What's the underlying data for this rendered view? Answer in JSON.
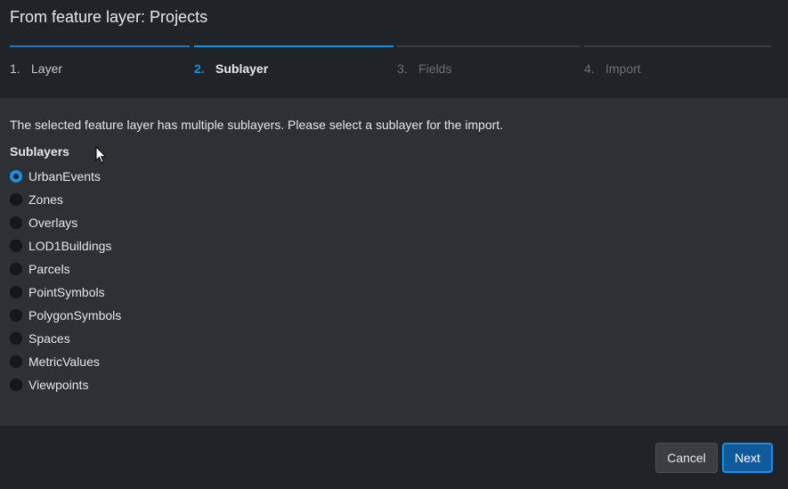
{
  "dialog": {
    "title": "From feature layer: Projects"
  },
  "steps": [
    {
      "num": "1.",
      "label": "Layer",
      "state": "done"
    },
    {
      "num": "2.",
      "label": "Sublayer",
      "state": "active"
    },
    {
      "num": "3.",
      "label": "Fields",
      "state": "pending"
    },
    {
      "num": "4.",
      "label": "Import",
      "state": "pending"
    }
  ],
  "content": {
    "intro": "The selected feature layer has multiple sublayers. Please select a sublayer for the import.",
    "group_label": "Sublayers",
    "selected": "UrbanEvents",
    "options": [
      "UrbanEvents",
      "Zones",
      "Overlays",
      "LOD1Buildings",
      "Parcels",
      "PointSymbols",
      "PolygonSymbols",
      "Spaces",
      "MetricValues",
      "Viewpoints"
    ]
  },
  "footer": {
    "cancel_label": "Cancel",
    "next_label": "Next"
  },
  "colors": {
    "accent": "#1a8fe3",
    "primary_button": "#0f5a9c",
    "content_bg": "#2d3034",
    "header_bg": "#202327"
  },
  "icons": {
    "cursor": "mouse-pointer-icon"
  }
}
